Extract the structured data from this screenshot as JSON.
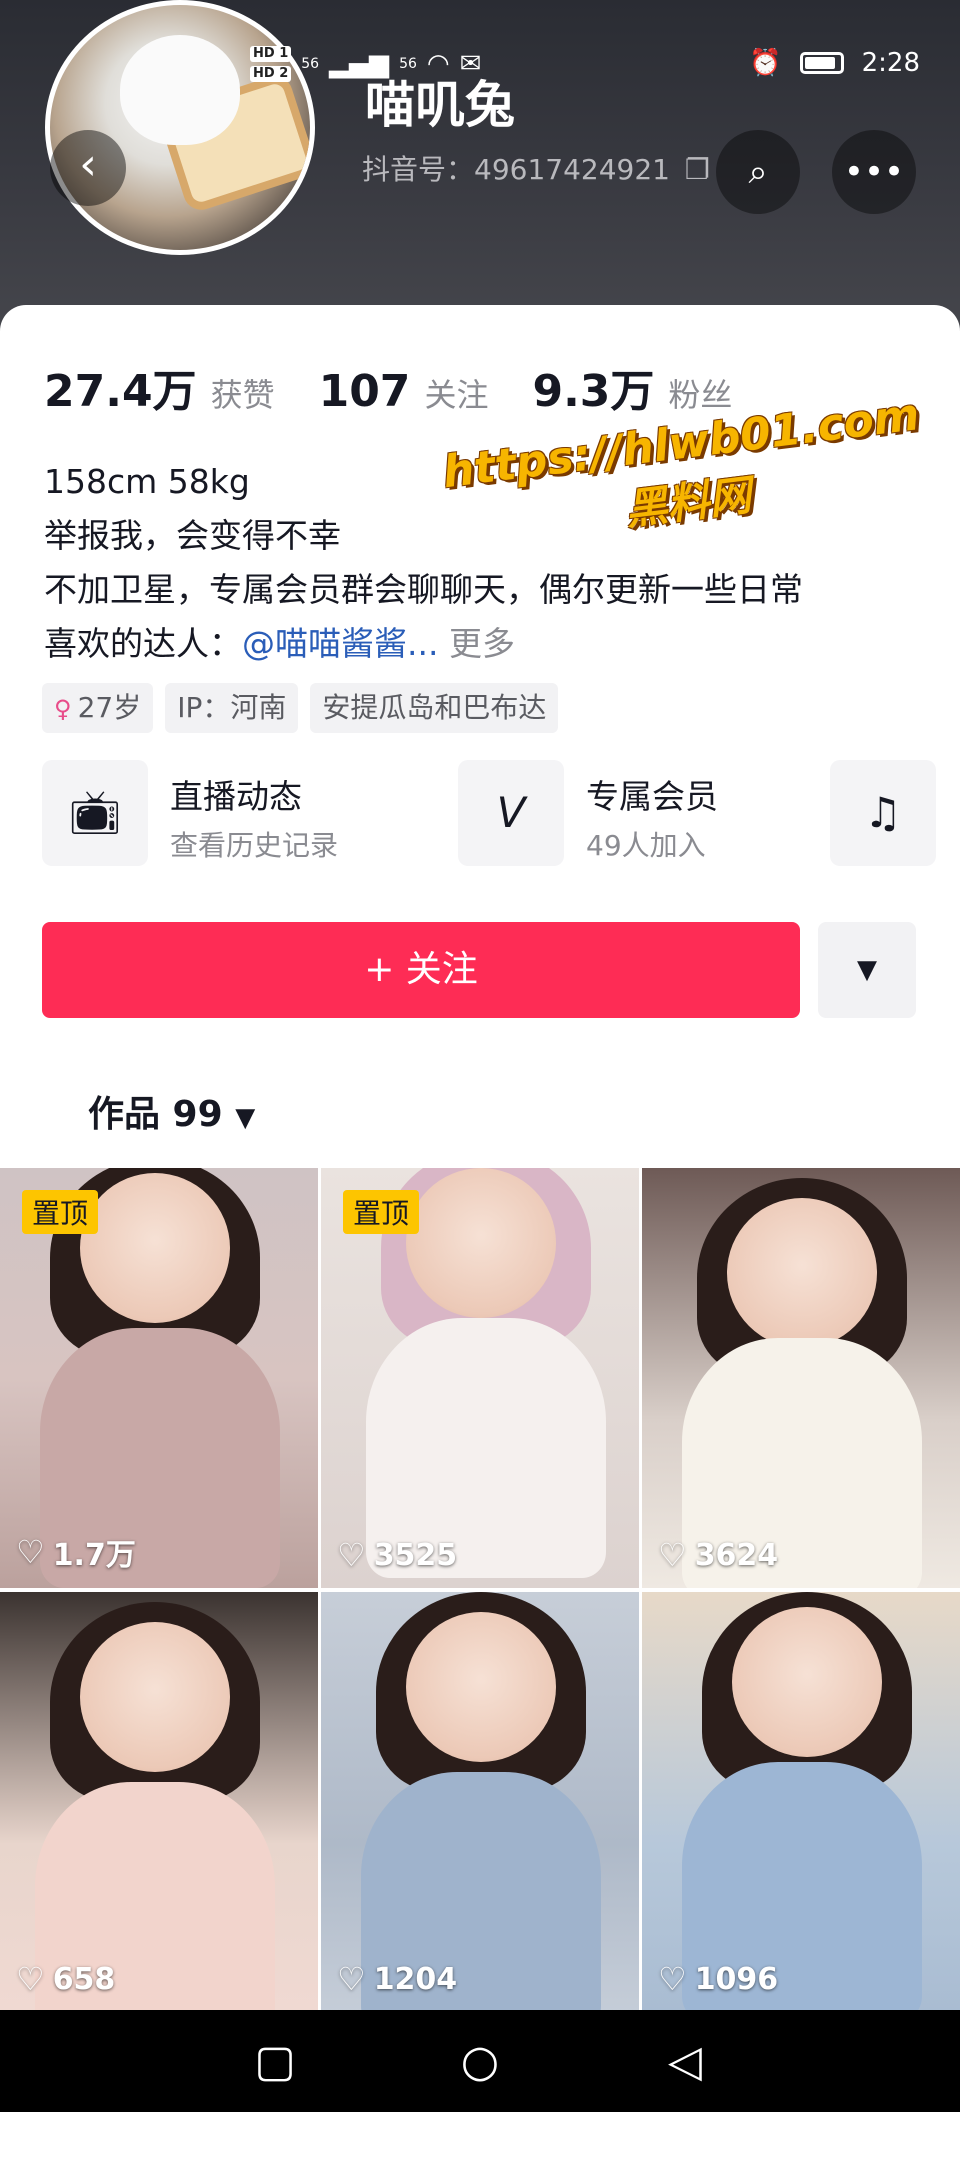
{
  "status_bar": {
    "hd1": "HD 1",
    "hd2": "HD 2",
    "signal1": "56",
    "signal2": "56",
    "time": "2:28"
  },
  "profile": {
    "username": "喵叽兔",
    "douyin_id": "抖音号：49617424921",
    "copy_icon": "copy-icon"
  },
  "stats": [
    {
      "value": "27.4万",
      "label": "获赞"
    },
    {
      "value": "107",
      "label": "关注"
    },
    {
      "value": "9.3万",
      "label": "粉丝"
    }
  ],
  "bio": {
    "line1": "158cm 58kg",
    "line2": "举报我，会变得不幸",
    "line3": "不加卫星，专属会员群会聊聊天，偶尔更新一些日常",
    "line4_prefix": "喜欢的达人：",
    "line4_mention": "@喵喵酱酱...",
    "line4_more": "更多"
  },
  "tags": {
    "age": "27岁",
    "ip": "IP：河南",
    "location": "安提瓜岛和巴布达"
  },
  "features": {
    "live": {
      "title": "直播动态",
      "subtitle": "查看历史记录"
    },
    "member": {
      "title": "专属会员",
      "subtitle": "49人加入"
    }
  },
  "actions": {
    "follow_label": "+ 关注",
    "dropdown_glyph": "▼"
  },
  "works_tab": {
    "label": "作品 99",
    "arrow": "▼"
  },
  "watermark": {
    "url": "https://hlwb01.com",
    "site": "黑料网"
  },
  "videos": [
    {
      "likes": "1.7万",
      "pinned": "置顶"
    },
    {
      "likes": "3525",
      "pinned": "置顶"
    },
    {
      "likes": "3624",
      "pinned": ""
    },
    {
      "likes": "658",
      "pinned": ""
    },
    {
      "likes": "1204",
      "pinned": ""
    },
    {
      "likes": "1096",
      "pinned": ""
    }
  ],
  "colors": {
    "accent": "#fe2c55",
    "pin_badge": "#fdc500",
    "mention": "#2a5db8"
  }
}
